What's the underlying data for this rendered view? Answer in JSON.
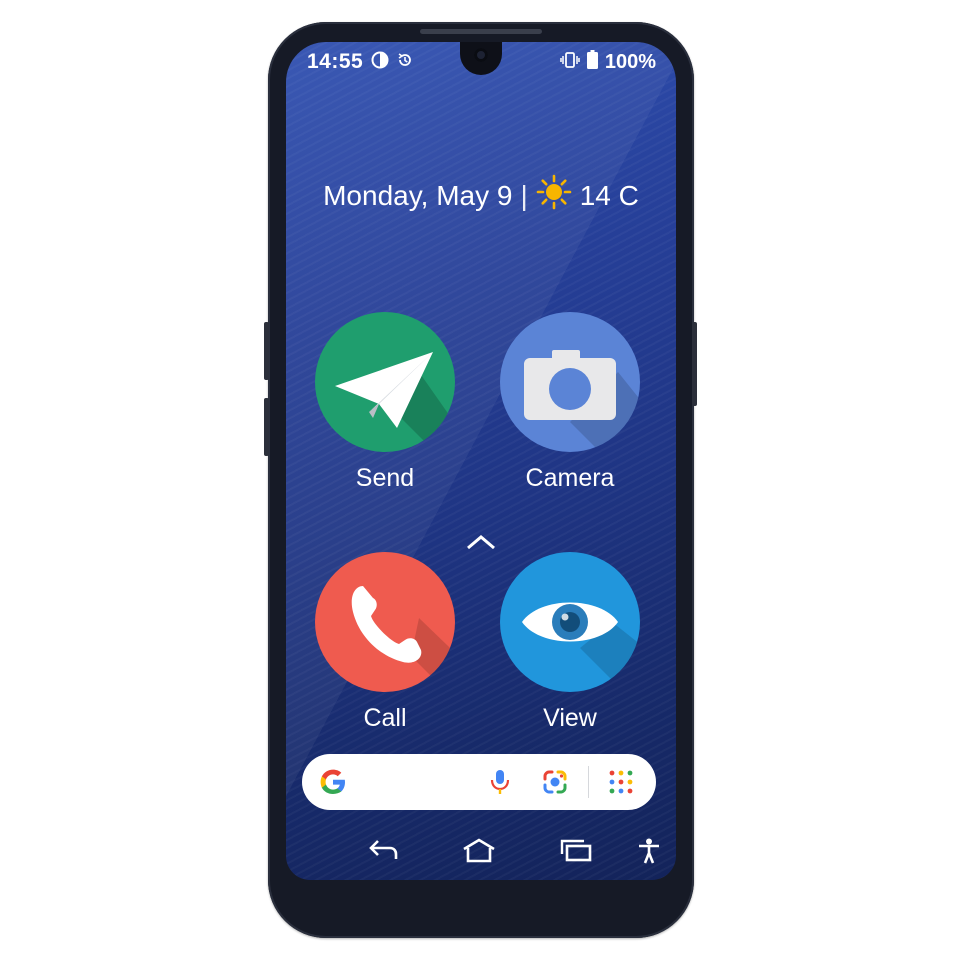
{
  "status_bar": {
    "time": "14:55",
    "battery": "100%",
    "left_icons": [
      "data-saver-icon",
      "sync-icon"
    ],
    "right_icons": [
      "vibrate-icon",
      "battery-icon"
    ]
  },
  "widget": {
    "date": "Monday, May 9",
    "separator": "|",
    "weather_icon": "sun-icon",
    "temperature": "14 C"
  },
  "apps": [
    {
      "label": "Send",
      "icon": "paper-plane-icon",
      "color": "#1f9e6e"
    },
    {
      "label": "Camera",
      "icon": "camera-icon",
      "color": "#5b84d6"
    },
    {
      "label": "Call",
      "icon": "phone-icon",
      "color": "#ef5b4f"
    },
    {
      "label": "View",
      "icon": "eye-icon",
      "color": "#2196dc"
    }
  ],
  "search": {
    "icons": [
      "google-logo-icon",
      "microphone-icon",
      "lens-icon",
      "apps-grid-icon"
    ]
  },
  "nav": {
    "icons": [
      "back-icon",
      "home-icon",
      "recents-icon",
      "accessibility-icon"
    ]
  },
  "colors": {
    "screen_top": "#2f4fb0",
    "screen_bottom": "#13235a",
    "phone_body": "#161a26"
  }
}
